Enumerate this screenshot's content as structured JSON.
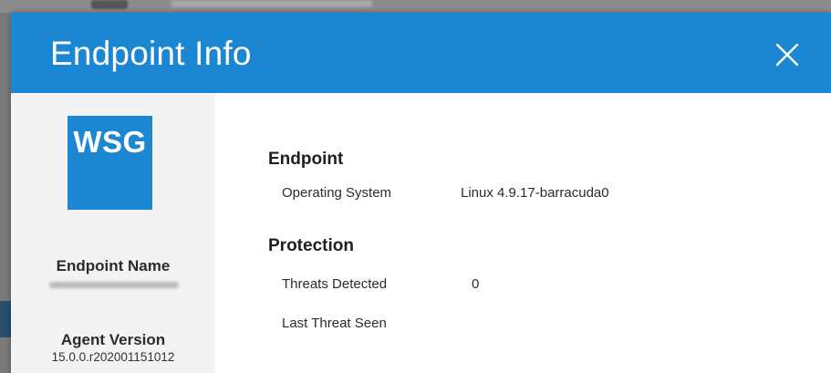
{
  "dialog": {
    "title": "Endpoint Info",
    "close_icon": "close-icon",
    "header_color": "#1b86d2"
  },
  "sidebar": {
    "logo_text": "WSG",
    "logo_color": "#1c87d3",
    "endpoint_name_label": "Endpoint Name",
    "agent_version_label": "Agent Version",
    "agent_version_value": "15.0.0.r202001151012"
  },
  "details": {
    "endpoint_section": {
      "title": "Endpoint",
      "rows": [
        {
          "label": "Operating System",
          "value": "Linux 4.9.17-barracuda0"
        }
      ]
    },
    "protection_section": {
      "title": "Protection",
      "rows": [
        {
          "label": "Threats Detected",
          "value": "0"
        },
        {
          "label": "Last Threat Seen",
          "value": ""
        }
      ]
    }
  }
}
